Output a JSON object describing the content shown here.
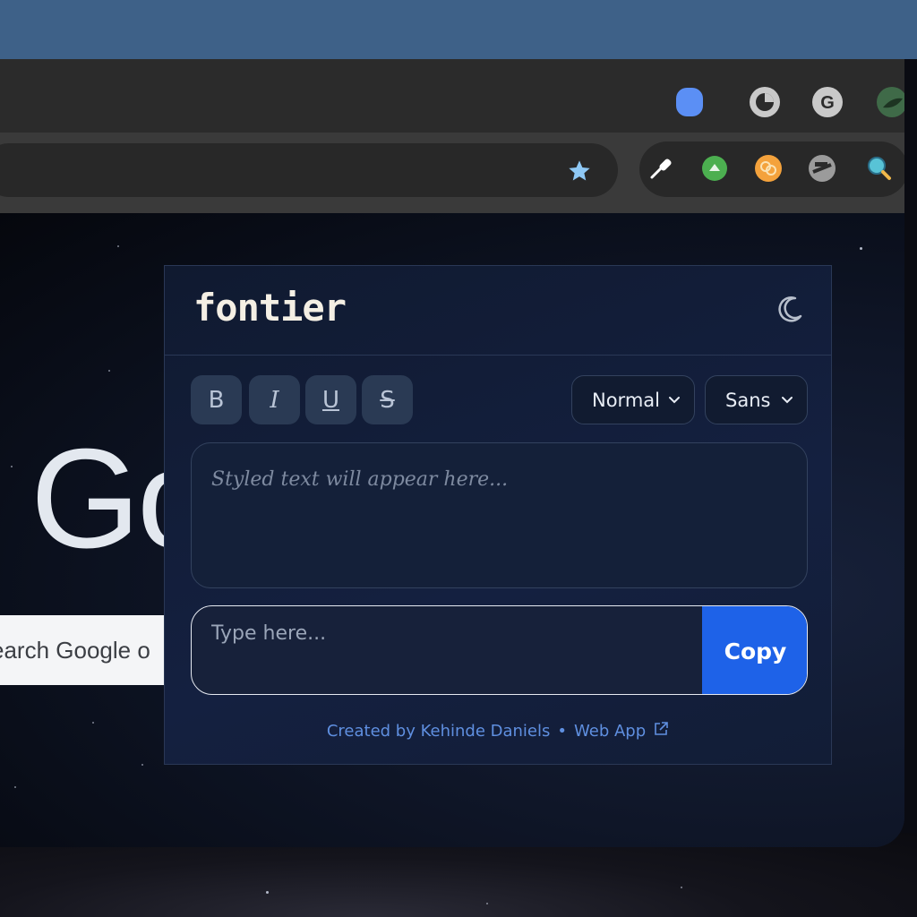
{
  "browser": {
    "toolbar": {
      "bookmark_icon": "star-icon",
      "extensions": [
        "eyedropper-icon",
        "green-extension-icon",
        "orange-extension-icon",
        "gray-extension-icon",
        "magnifier-extension-icon"
      ]
    },
    "tab_icons": [
      "blue-tab-icon",
      "clock-tab-icon",
      "google-tab-icon",
      "green-tab-icon"
    ]
  },
  "google_page": {
    "logo_partial": "Go",
    "search_partial": "earch Google o"
  },
  "fontier": {
    "title": "fontier",
    "theme_icon": "moon-icon",
    "format_buttons": [
      {
        "label": "B",
        "name": "bold"
      },
      {
        "label": "I",
        "name": "italic"
      },
      {
        "label": "U",
        "name": "underline"
      },
      {
        "label": "S",
        "name": "strikethrough"
      }
    ],
    "size_select": "Normal",
    "font_select": "Sans",
    "output_placeholder": "Styled text will appear here...",
    "input_placeholder": "Type here...",
    "copy_label": "Copy",
    "footer": {
      "credit": "Created by Kehinde Daniels",
      "separator": "•",
      "link_label": "Web App"
    },
    "colors": {
      "accent": "#1e62e8",
      "link": "#5f8fe0",
      "background": "#121d36"
    }
  }
}
